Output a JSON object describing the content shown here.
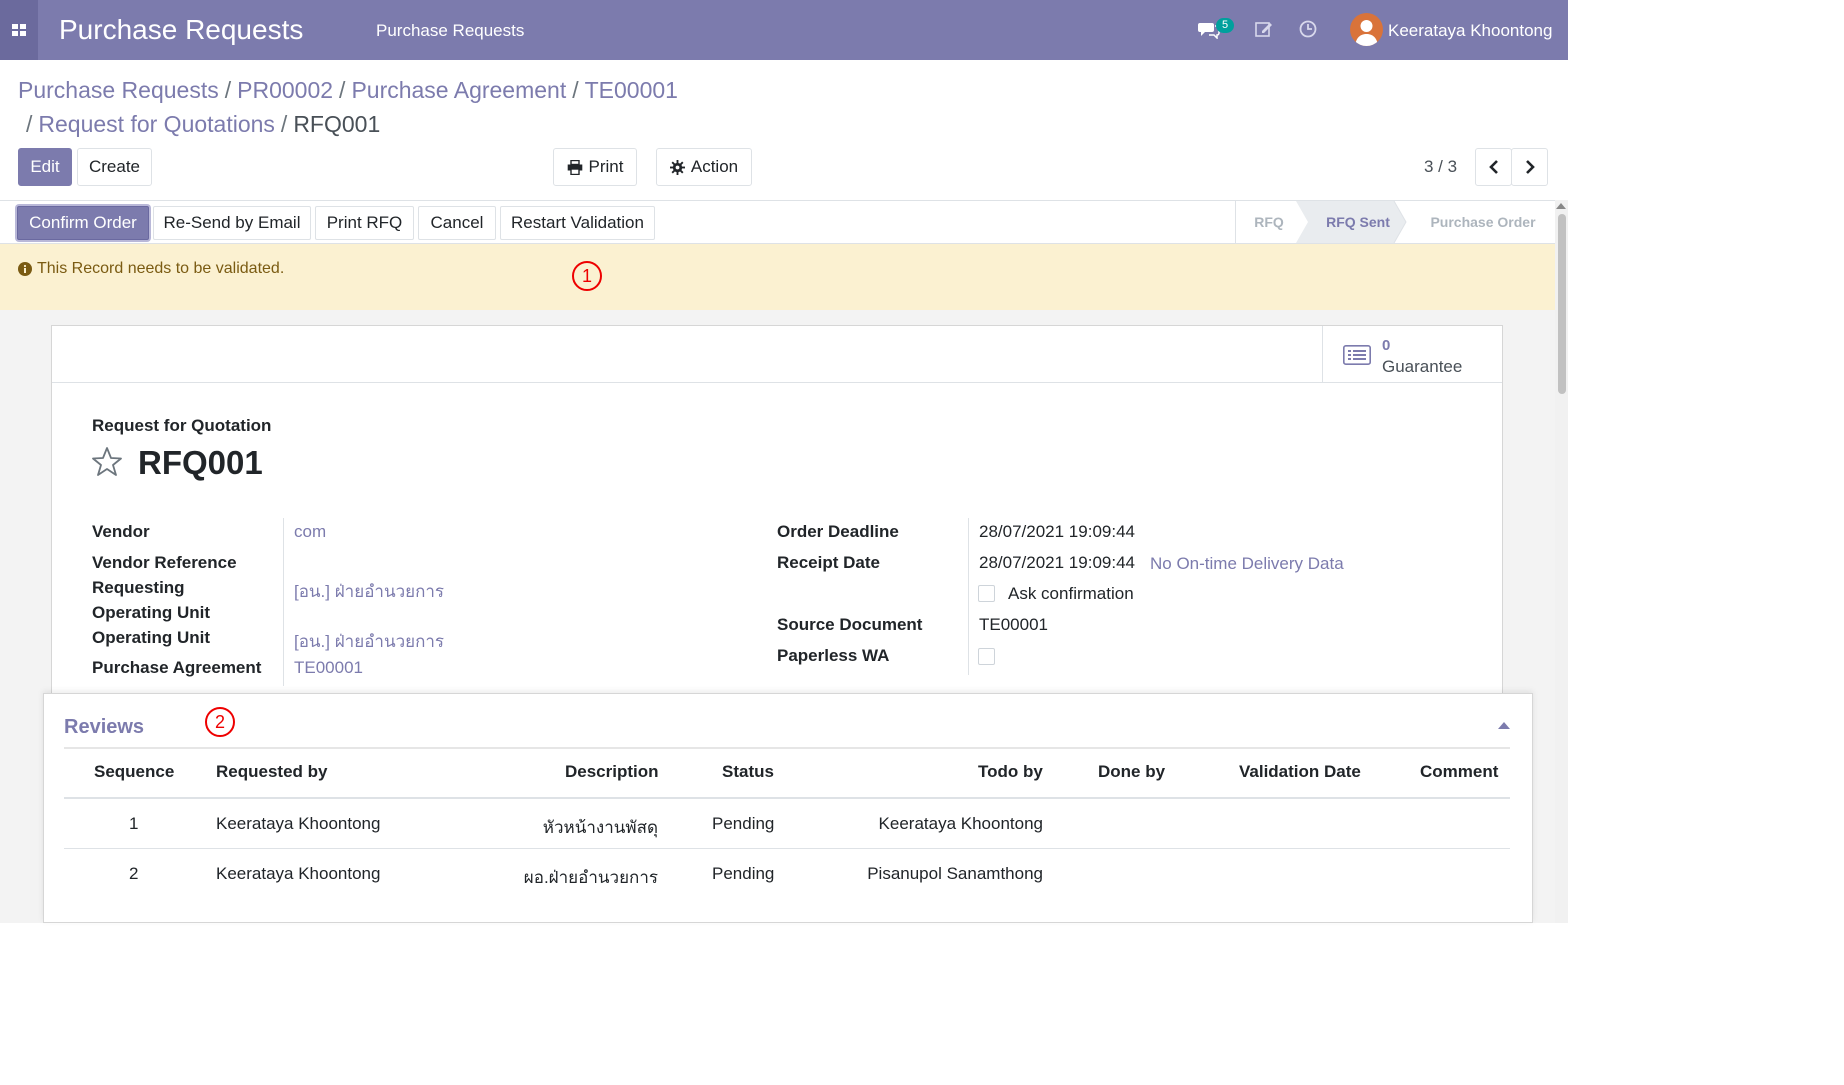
{
  "navbar": {
    "app_title": "Purchase Requests",
    "menu_item": "Purchase Requests",
    "messages_count": "5",
    "user_name": "Keerataya Khoontong"
  },
  "breadcrumb": {
    "items": [
      "Purchase Requests",
      "PR00002",
      "Purchase Agreement",
      "TE00001",
      "Request for Quotations"
    ],
    "current": "RFQ001"
  },
  "control_panel": {
    "edit_label": "Edit",
    "create_label": "Create",
    "print_label": "Print",
    "action_label": "Action",
    "pager_value": "3 / 3"
  },
  "statusbar": {
    "buttons": [
      "Confirm Order",
      "Re-Send by Email",
      "Print RFQ",
      "Cancel",
      "Restart Validation"
    ],
    "stages": [
      "RFQ",
      "RFQ Sent",
      "Purchase Order"
    ],
    "active_stage": "RFQ Sent"
  },
  "alert": {
    "message": "This Record needs to be validated.",
    "marker": "1"
  },
  "smart_button": {
    "count": "0",
    "label": "Guarantee"
  },
  "form": {
    "doc_type_label": "Request for Quotation",
    "doc_name": "RFQ001",
    "left_fields": [
      {
        "label": "Vendor",
        "value": "com"
      },
      {
        "label": "Vendor Reference",
        "value": ""
      },
      {
        "label": "Requesting",
        "value": "[อน.] ฝ่ายอำนวยการ"
      },
      {
        "label": "Operating Unit",
        "value": ""
      },
      {
        "label": "Operating Unit",
        "value": "[อน.] ฝ่ายอำนวยการ"
      },
      {
        "label": "Purchase Agreement",
        "value": "TE00001"
      }
    ],
    "right_fields": {
      "order_deadline_label": "Order Deadline",
      "order_deadline": "28/07/2021 19:09:44",
      "receipt_date_label": "Receipt Date",
      "receipt_date": "28/07/2021 19:09:44",
      "on_time_link": "No On-time Delivery Data",
      "ask_confirmation_label": "Ask confirmation",
      "source_document_label": "Source Document",
      "source_document": "TE00001",
      "paperless_label": "Paperless WA"
    }
  },
  "reviews": {
    "title": "Reviews",
    "marker": "2",
    "columns": [
      "Sequence",
      "Requested by",
      "Description",
      "Status",
      "Todo by",
      "Done by",
      "Validation Date",
      "Comment"
    ],
    "rows": [
      {
        "sequence": "1",
        "requested_by": "Keerataya Khoontong",
        "description": "หัวหน้างานพัสดุ",
        "status": "Pending",
        "todo_by": "Keerataya Khoontong",
        "done_by": "",
        "validation_date": "",
        "comment": ""
      },
      {
        "sequence": "2",
        "requested_by": "Keerataya Khoontong",
        "description": "ผอ.ฝ่ายอำนวยการ",
        "status": "Pending",
        "todo_by": "Pisanupol Sanamthong",
        "done_by": "",
        "validation_date": "",
        "comment": ""
      }
    ]
  },
  "colors": {
    "brand": "#7c7bad",
    "alert_bg": "#fbf1d1",
    "badge": "#00a09d"
  },
  "icons": [
    "apps-grid-icon",
    "chat-icon",
    "edit-note-icon",
    "clock-icon",
    "print-icon",
    "gear-icon",
    "chevron-left-icon",
    "chevron-right-icon",
    "info-icon",
    "list-icon",
    "star-icon",
    "caret-up-icon"
  ]
}
